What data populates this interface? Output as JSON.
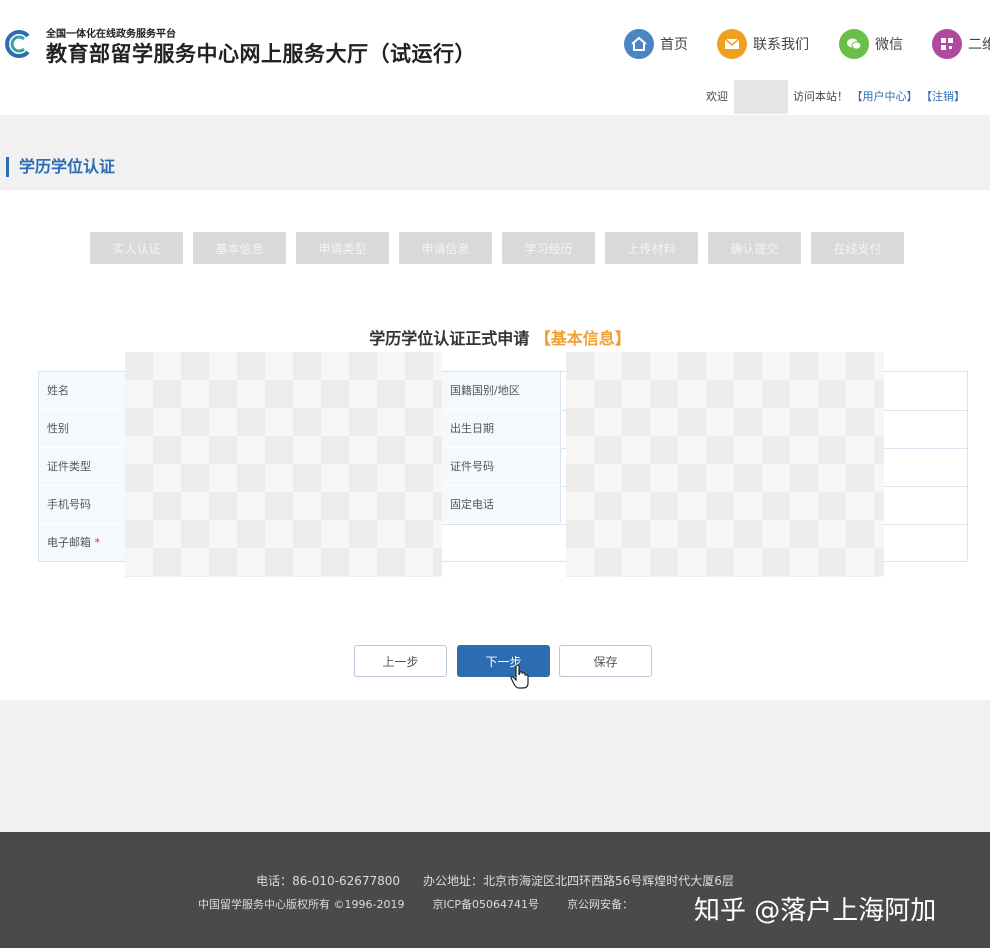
{
  "header": {
    "subtitle": "全国一体化在线政务服务平台",
    "title": "教育部留学服务中心网上服务大厅（试运行）",
    "nav": [
      {
        "label": "首页",
        "icon": "home-icon",
        "color": "#4a86c5"
      },
      {
        "label": "联系我们",
        "icon": "mail-icon",
        "color": "#f0a020"
      },
      {
        "label": "微信",
        "icon": "wechat-icon",
        "color": "#6abf4b"
      },
      {
        "label": "二维",
        "icon": "qrcode-icon",
        "color": "#b04aa0"
      }
    ],
    "welcome_prefix": "欢迎",
    "welcome_suffix": "访问本站！",
    "user_center": "【用户中心】",
    "logout": "【注销】"
  },
  "section_title": "学历学位认证",
  "steps": [
    "实人认证",
    "基本信息",
    "申请类型",
    "申请信息",
    "学习经历",
    "上传材料",
    "确认提交",
    "在线支付"
  ],
  "form": {
    "title": "学历学位认证正式申请",
    "title_tag": "【基本信息】",
    "left_labels": [
      "姓名",
      "性别",
      "证件类型",
      "手机号码",
      "电子邮箱"
    ],
    "required_mark": "*",
    "right_labels": [
      "国籍国别/地区",
      "出生日期",
      "证件号码",
      "固定电话"
    ]
  },
  "buttons": {
    "prev": "上一步",
    "next": "下一步",
    "save": "保存"
  },
  "footer": {
    "line1": "电话：86-010-62677800      办公地址：北京市海淀区北四环西路56号辉煌时代大厦6层",
    "line2": "中国留学服务中心版权所有 ©1996-2019        京ICP备05064741号        京公网安备：",
    "watermark": "知乎 @落户上海阿加"
  },
  "colors": {
    "accent": "#2d6cb0",
    "highlight": "#f0a030",
    "footer_bg": "#4a4a4a"
  }
}
